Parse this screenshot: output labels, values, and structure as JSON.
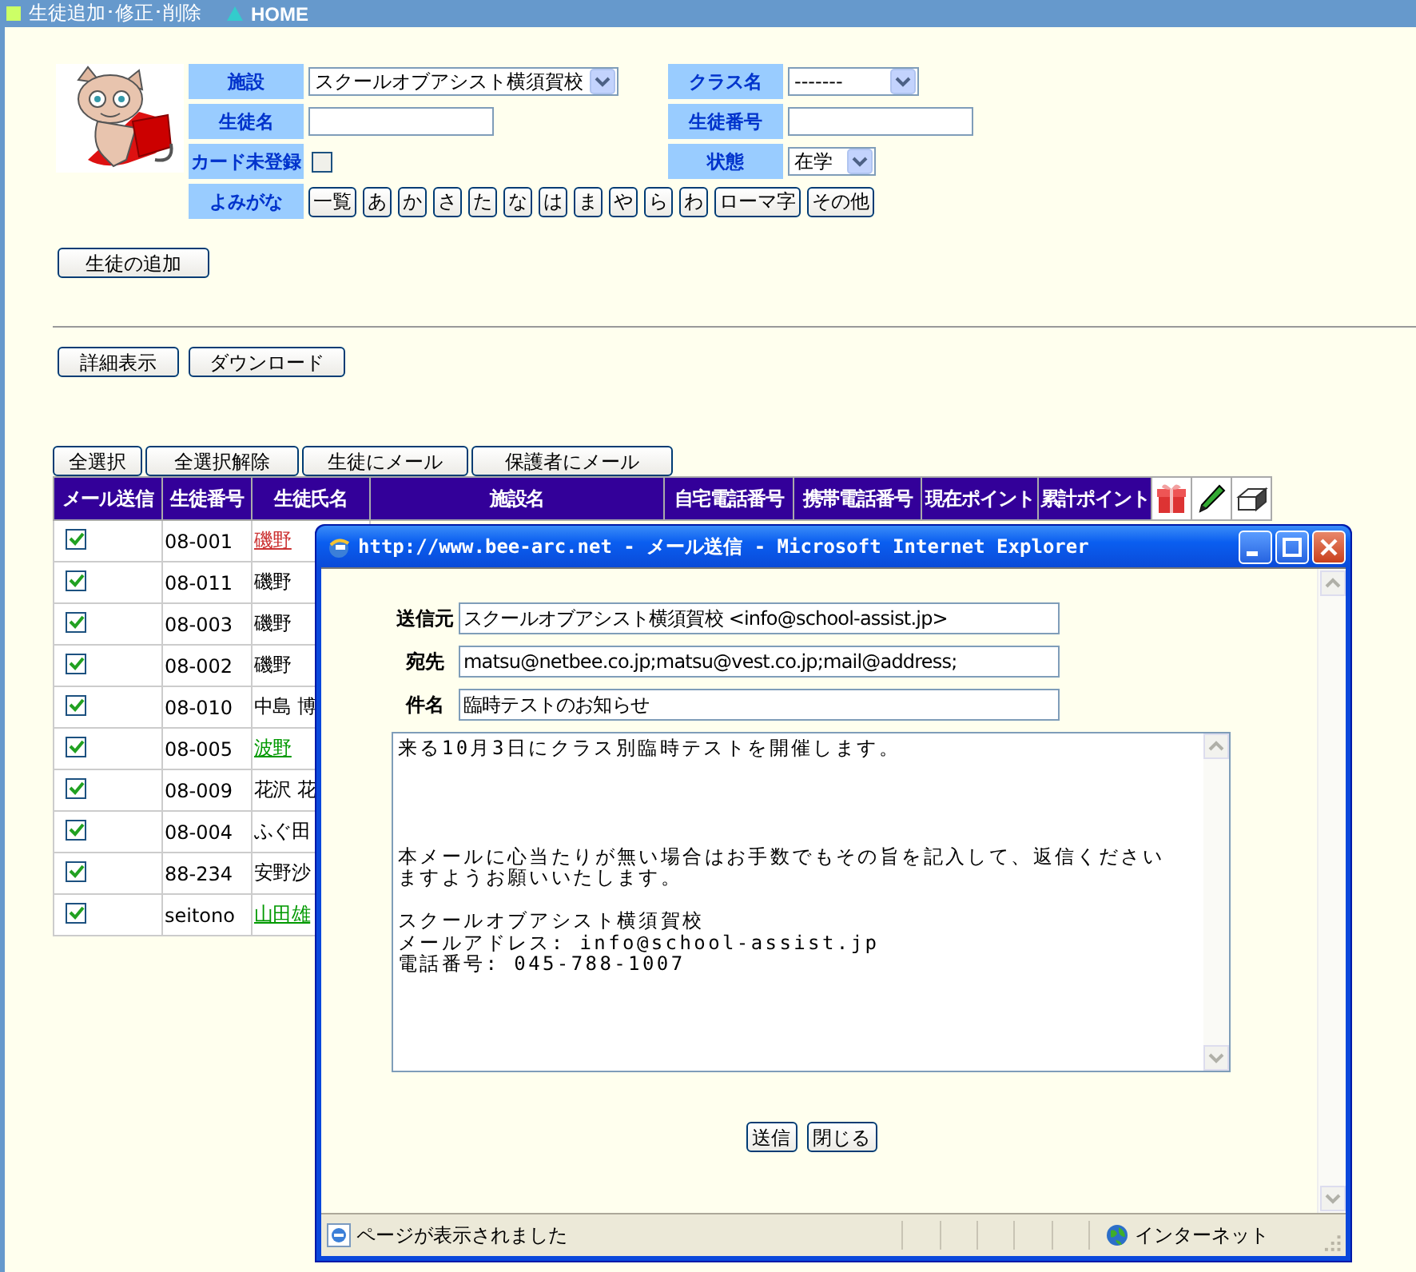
{
  "header": {
    "items": [
      {
        "kind": "square",
        "text": "生徒追加･修正･削除"
      },
      {
        "kind": "triangle",
        "text": "HOME"
      }
    ]
  },
  "filters": {
    "facility": {
      "label": "施設",
      "value": "スクールオブアシスト横須賀校"
    },
    "class": {
      "label": "クラス名",
      "value": "-------"
    },
    "student_name": {
      "label": "生徒名"
    },
    "student_number": {
      "label": "生徒番号"
    },
    "card": {
      "label": "カード未登録",
      "checked": false
    },
    "status": {
      "label": "状態",
      "value": "在学"
    },
    "kana": {
      "label": "よみがな",
      "buttons": [
        "一覧",
        "あ",
        "か",
        "さ",
        "た",
        "な",
        "は",
        "ま",
        "や",
        "ら",
        "わ",
        "ローマ字",
        "その他"
      ]
    }
  },
  "add_button": "生徒の追加",
  "view_buttons": [
    "詳細表示",
    "ダウンロード"
  ],
  "select_buttons": [
    "全選択",
    "全選択解除",
    "生徒にメール",
    "保護者にメール"
  ],
  "table": {
    "columns": [
      "メール送信",
      "生徒番号",
      "生徒氏名",
      "施設名",
      "自宅電話番号",
      "携帯電話番号",
      "現在ポイント",
      "累計ポイント"
    ],
    "rows": [
      {
        "checked": true,
        "number": "08-001",
        "name": "磯野",
        "kind": "link",
        "color": "#cc3333"
      },
      {
        "checked": true,
        "number": "08-011",
        "name": "磯野",
        "kind": "text",
        "color": "#000000"
      },
      {
        "checked": true,
        "number": "08-003",
        "name": "磯野",
        "kind": "text",
        "color": "#000000"
      },
      {
        "checked": true,
        "number": "08-002",
        "name": "磯野",
        "kind": "text",
        "color": "#000000"
      },
      {
        "checked": true,
        "number": "08-010",
        "name": "中島 博",
        "kind": "text",
        "color": "#000000"
      },
      {
        "checked": true,
        "number": "08-005",
        "name": "波野",
        "kind": "link",
        "color": "#009900"
      },
      {
        "checked": true,
        "number": "08-009",
        "name": "花沢 花",
        "kind": "text",
        "color": "#000000"
      },
      {
        "checked": true,
        "number": "08-004",
        "name": "ふぐ田",
        "kind": "text",
        "color": "#000000"
      },
      {
        "checked": true,
        "number": "88-234",
        "name": "安野沙",
        "kind": "text",
        "color": "#000000"
      },
      {
        "checked": true,
        "number": "seitono",
        "name": "山田雄",
        "kind": "link",
        "color": "#009900"
      }
    ]
  },
  "popup": {
    "title": "http://www.bee-arc.net - メール送信 - Microsoft Internet Explorer",
    "fields": [
      {
        "label": "送信元",
        "value": "スクールオブアシスト横須賀校 <info@school-assist.jp>"
      },
      {
        "label": "宛先",
        "value": "matsu@netbee.co.jp;matsu@vest.co.jp;mail@address;"
      },
      {
        "label": "件名",
        "value": "臨時テストのお知らせ"
      }
    ],
    "message": [
      [
        "来る10月3日にクラス別臨時テストを開催します。"
      ],
      [
        "本メールに心当たりが無い場合はお手数でもその旨を記入して、返信くださいますようお願いいたします。"
      ],
      [
        "スクールオブアシスト横須賀校",
        "メールアドレス: info@school-assist.jp",
        "電話番号: 045-788-1007"
      ]
    ],
    "buttons": [
      "送信",
      "閉じる"
    ],
    "status": "ページが表示されました",
    "zone": "インターネット"
  }
}
